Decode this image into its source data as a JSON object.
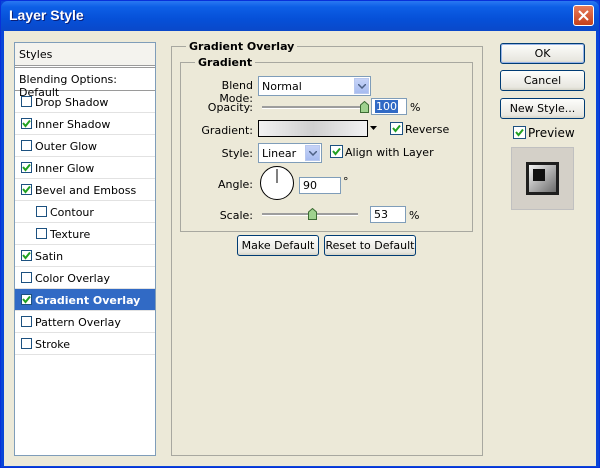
{
  "window": {
    "title": "Layer Style"
  },
  "sidebar": {
    "header": "Styles",
    "blending": "Blending Options: Default",
    "items": [
      {
        "label": "Drop Shadow",
        "checked": false,
        "indent": false,
        "selected": false
      },
      {
        "label": "Inner Shadow",
        "checked": true,
        "indent": false,
        "selected": false
      },
      {
        "label": "Outer Glow",
        "checked": false,
        "indent": false,
        "selected": false
      },
      {
        "label": "Inner Glow",
        "checked": true,
        "indent": false,
        "selected": false
      },
      {
        "label": "Bevel and Emboss",
        "checked": true,
        "indent": false,
        "selected": false
      },
      {
        "label": "Contour",
        "checked": false,
        "indent": true,
        "selected": false
      },
      {
        "label": "Texture",
        "checked": false,
        "indent": true,
        "selected": false
      },
      {
        "label": "Satin",
        "checked": true,
        "indent": false,
        "selected": false
      },
      {
        "label": "Color Overlay",
        "checked": false,
        "indent": false,
        "selected": false
      },
      {
        "label": "Gradient Overlay",
        "checked": true,
        "indent": false,
        "selected": true
      },
      {
        "label": "Pattern Overlay",
        "checked": false,
        "indent": false,
        "selected": false
      },
      {
        "label": "Stroke",
        "checked": false,
        "indent": false,
        "selected": false
      }
    ]
  },
  "main": {
    "section_title": "Gradient Overlay",
    "group_title": "Gradient",
    "blend_mode": {
      "label": "Blend Mode:",
      "value": "Normal"
    },
    "opacity": {
      "label": "Opacity:",
      "value": "100",
      "unit": "%",
      "percent": 100
    },
    "gradient": {
      "label": "Gradient:",
      "reverse_label": "Reverse",
      "reverse_checked": true
    },
    "style": {
      "label": "Style:",
      "value": "Linear",
      "align_label": "Align with Layer",
      "align_checked": true
    },
    "angle": {
      "label": "Angle:",
      "value": "90",
      "unit": "°"
    },
    "scale": {
      "label": "Scale:",
      "value": "53",
      "unit": "%",
      "percent": 53
    },
    "make_default": "Make Default",
    "reset_default": "Reset to Default"
  },
  "right": {
    "ok": "OK",
    "cancel": "Cancel",
    "new_style": "New Style...",
    "preview_label": "Preview",
    "preview_checked": true
  },
  "colors": {
    "selection": "#316ac5",
    "titlebar": "#0a46d8",
    "dialog_bg": "#ece9d8"
  }
}
